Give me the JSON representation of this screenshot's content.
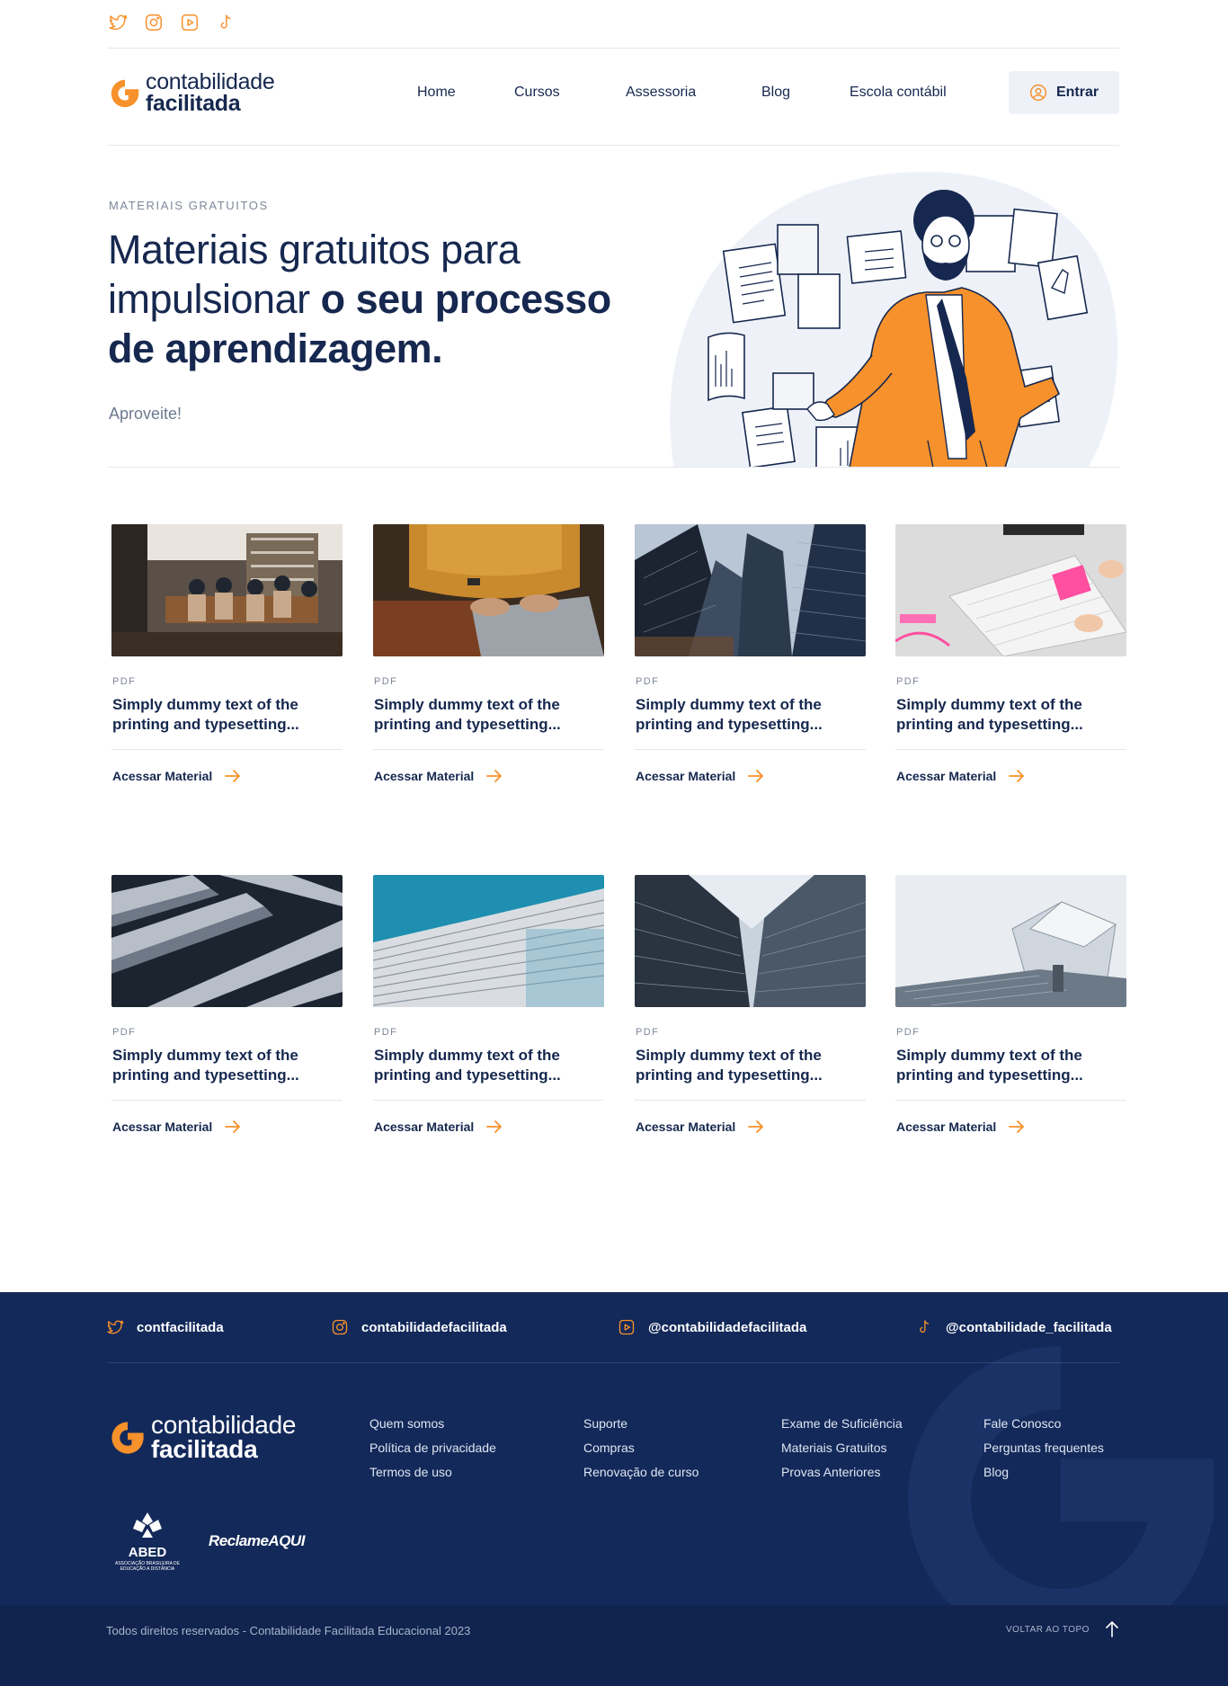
{
  "colors": {
    "brand_orange": "#f7912b",
    "navy": "#16284f",
    "footer_bg": "#13295a",
    "footer_bottom_bg": "#10244f",
    "muted_text": "#7d8799"
  },
  "top_social": {
    "icons": [
      "twitter-icon",
      "instagram-icon",
      "youtube-icon",
      "tiktok-icon"
    ]
  },
  "header": {
    "logo": {
      "line1": "contabilidade",
      "line2": "facilitada"
    },
    "nav": [
      "Home",
      "Cursos",
      "Assessoria",
      "Blog",
      "Escola contábil"
    ],
    "login_label": "Entrar"
  },
  "hero": {
    "eyebrow": "MATERIAIS GRATUITOS",
    "title_regular": "Materiais gratuitos para impulsionar ",
    "title_bold": "o seu processo de aprendizagem.",
    "subtitle": "Aproveite!"
  },
  "materials": {
    "cards": [
      {
        "type": "PDF",
        "title": "Simply dummy text of the printing and typesetting...",
        "link": "Acessar Material",
        "image": "team-meeting-office"
      },
      {
        "type": "PDF",
        "title": "Simply dummy text of the printing and typesetting...",
        "link": "Acessar Material",
        "image": "person-typing-laptop"
      },
      {
        "type": "PDF",
        "title": "Simply dummy text of the printing and typesetting...",
        "link": "Acessar Material",
        "image": "skyscrapers-looking-up"
      },
      {
        "type": "PDF",
        "title": "Simply dummy text of the printing and typesetting...",
        "link": "Acessar Material",
        "image": "desk-calendar-sticky-note"
      },
      {
        "type": "PDF",
        "title": "Simply dummy text of the printing and typesetting...",
        "link": "Acessar Material",
        "image": "building-balconies"
      },
      {
        "type": "PDF",
        "title": "Simply dummy text of the printing and typesetting...",
        "link": "Acessar Material",
        "image": "facade-blue-sky"
      },
      {
        "type": "PDF",
        "title": "Simply dummy text of the printing and typesetting...",
        "link": "Acessar Material",
        "image": "glass-towers-sky"
      },
      {
        "type": "PDF",
        "title": "Simply dummy text of the printing and typesetting...",
        "link": "Acessar Material",
        "image": "modern-building-white"
      }
    ]
  },
  "footer": {
    "social": [
      {
        "icon": "twitter-icon",
        "handle": "contfacilitada"
      },
      {
        "icon": "instagram-icon",
        "handle": "contabilidadefacilitada"
      },
      {
        "icon": "youtube-icon",
        "handle": "@contabilidadefacilitada"
      },
      {
        "icon": "tiktok-icon",
        "handle": "@contabilidade_facilitada"
      }
    ],
    "logo": {
      "line1": "contabilidade",
      "line2": "facilitada"
    },
    "columns": [
      [
        "Quem somos",
        "Política de privacidade",
        "Termos de uso"
      ],
      [
        "Suporte",
        "Compras",
        "Renovação de curso"
      ],
      [
        "Exame de Suficiência",
        "Materiais Gratuitos",
        "Provas Anteriores"
      ],
      [
        "Fale Conosco",
        "Perguntas frequentes",
        "Blog"
      ]
    ],
    "badges": {
      "abed_name": "ABED",
      "abed_caption": "ASSOCIAÇÃO BRASILEIRA DE EDUCAÇÃO A DISTÂNCIA",
      "reclame": "ReclameAQUI"
    },
    "copyright": "Todos direitos reservados - Contabilidade Facilitada Educacional 2023",
    "back_to_top": "VOLTAR AO TOPO"
  }
}
